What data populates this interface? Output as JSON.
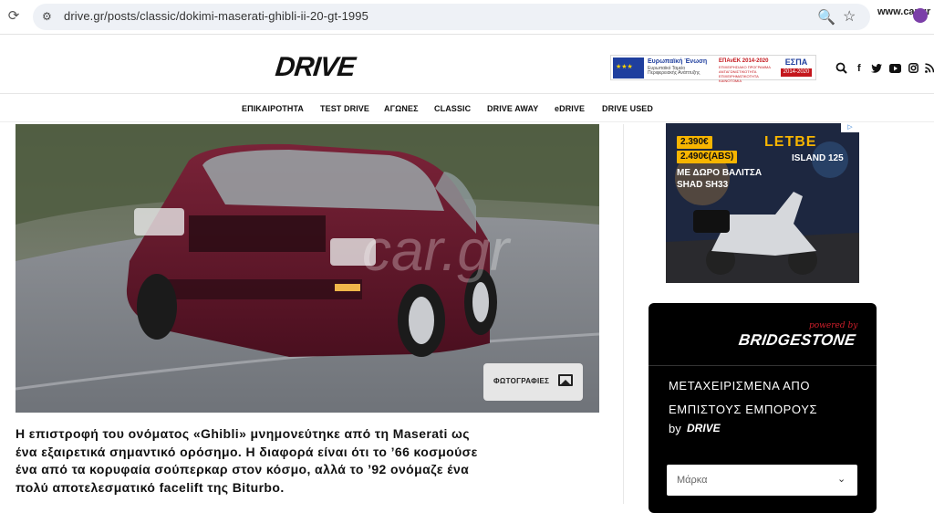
{
  "browser": {
    "url": "drive.gr/posts/classic/dokimi-maserati-ghibli-ii-20-gt-1995",
    "profile_label": "www.car.gr"
  },
  "header": {
    "logo": "DRIVE",
    "eu_banner": {
      "title": "Ευρωπαϊκή Ένωση",
      "subtitle": "Ευρωπαϊκό Ταμείο Περιφερειακής Ανάπτυξης",
      "program": "ΕΠΑνΕΚ 2014-2020",
      "program_sub": "ΕΠΙΧΕΙΡΗΣΙΑΚΟ ΠΡΟΓΡΑΜΜΑ ΑΝΤΑΓΩΝΙΣΤΙΚΟΤΗΤΑ ΕΠΙΧΕΙΡΗΜΑΤΙΚΟΤΗΤΑ ΚΑΙΝΟΤΟΜΙΑ",
      "espa": "ΕΣΠΑ",
      "espa_years": "2014-2020"
    }
  },
  "nav": {
    "items": [
      "ΕΠΙΚΑΙΡΟΤΗΤΑ",
      "TEST DRIVE",
      "ΑΓΩΝΕΣ",
      "CLASSIC",
      "DRIVE AWAY",
      "eDRIVE",
      "DRIVE USED"
    ]
  },
  "article": {
    "photos_label": "ΦΩΤΟΓΡΑΦΙΕΣ",
    "watermark": "car.gr",
    "lead_lines": [
      "Η επιστροφή του ονόματος «Ghibli» μνημονεύτηκε από τη Maserati ως",
      "ένα εξαιρετικά σημαντικό ορόσημο. Η διαφορά είναι ότι το ’66 κοσμούσε",
      "ένα από τα κορυφαία σούπερκαρ στον κόσμο, αλλά το ’92 ονόμαζε ένα",
      "πολύ αποτελεσματικό facelift της Biturbo."
    ]
  },
  "ad": {
    "price1": "2.390€",
    "price2": "2.490€(ABS)",
    "brand": "LETBE",
    "model": "ISLAND 125",
    "gift": "ΜΕ ΔΩΡΟ ΒΑΛΙΤΣΑ SHAD SH33",
    "badge": "▷"
  },
  "widget": {
    "powered": "powered by",
    "brand": "BRIDGESTONE",
    "title": "ΜΕΤΑΧΕΙΡΙΣΜΕΝΑ ΑΠΟ ΕΜΠΙΣΤΟΥΣ ΕΜΠΟΡΟΥΣ",
    "by": "by",
    "by_brand": "DRIVE",
    "select_placeholder": "Μάρκα"
  }
}
